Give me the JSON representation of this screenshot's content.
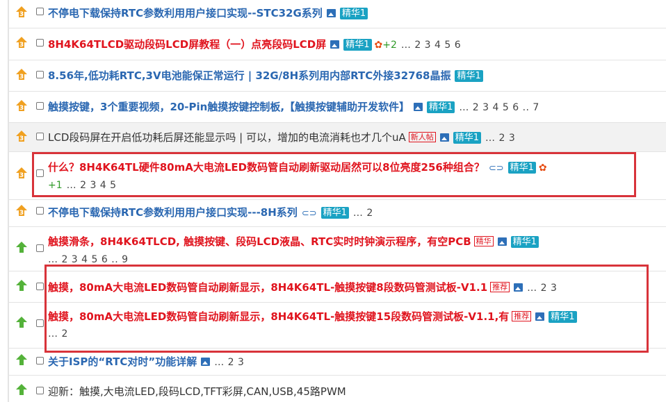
{
  "threads": [
    {
      "icon": "hot-3-icon",
      "title": "不停电下载保持RTC参数利用用户接口实现--STC32G系列",
      "color": "blue",
      "has_image": true,
      "badge": "精华1",
      "pages": ""
    },
    {
      "icon": "hot-3-icon",
      "title": "8H4K64TLCD驱动段码LCD屏教程（一）点亮段码LCD屏",
      "color": "red",
      "has_image": true,
      "badge": "精华1",
      "plus": "+2",
      "pages": "… 2 3 4 5 6"
    },
    {
      "icon": "hot-3-icon",
      "title": "8.56年,低功耗RTC,3V电池能保正常运行 | 32G/8H系列用内部RTC外接32768晶振",
      "color": "blue",
      "has_image": false,
      "badge": "精华1",
      "pages": ""
    },
    {
      "icon": "hot-3-icon",
      "title": "触摸按键，3个重要视频，20-Pin触摸按键控制板,【触摸按键辅助开发软件】",
      "color": "blue",
      "has_image": true,
      "badge": "精华1",
      "pages": "… 2 3 4 5 6 .. 7"
    },
    {
      "icon": "hot-3-icon",
      "title": "LCD段码屏在开启低功耗后屏还能显示吗 | 可以，增加的电流消耗也才几个uA",
      "color": "normal",
      "newbie": "新人帖",
      "has_image": true,
      "badge": "精华1",
      "pages": "… 2 3"
    },
    {
      "icon": "hot-3-icon",
      "title": "什么？8H4K64TL硬件80mA大电流LED数码管自动刷新驱动居然可以8位亮度256种组合？",
      "color": "red",
      "has_clip": true,
      "badge": "精华1",
      "plus": "+1",
      "pages": "… 2 3 4 5"
    },
    {
      "icon": "hot-3-icon",
      "title": "不停电下载保持RTC参数利用用户接口实现---8H系列",
      "color": "blue",
      "has_clip": true,
      "badge": "精华1",
      "pages": "… 2"
    },
    {
      "icon": "up-arrow-icon",
      "title": "触摸滑条，8H4K64TLCD, 触摸按键、段码LCD液晶、RTC实时时钟演示程序，有空PCB",
      "color": "red",
      "tag": "精华",
      "badge": "精华1",
      "pages": "… 2 3 4 5 6 .. 9"
    },
    {
      "icon": "up-arrow-icon",
      "title": "触摸，80mA大电流LED数码管自动刷新显示，8H4K64TL-触摸按键8段数码管测试板-V1.1",
      "color": "red",
      "tag": "推荐",
      "has_image": true,
      "pages": "… 2 3"
    },
    {
      "icon": "up-arrow-icon",
      "title": "触摸，80mA大电流LED数码管自动刷新显示，8H4K64TL-触摸按键15段数码管测试板-V1.1,有",
      "color": "red",
      "tag": "推荐",
      "has_image": true,
      "badge": "精华1",
      "pages": "… 2"
    },
    {
      "icon": "up-arrow-icon",
      "title": "关于ISP的“RTC对时”功能详解",
      "color": "blue",
      "has_image": true,
      "pages": "… 2 3"
    },
    {
      "icon": "up-arrow-icon",
      "title": "迎新：触摸,大电流LED,段码LCD,TFT彩屏,CAN,USB,45路PWM",
      "color": "normal",
      "pages": ""
    }
  ],
  "colors": {
    "blue": "#2a67b1",
    "red": "#e0141e",
    "badge": "#1aa2c3",
    "highlight": "#d8333a",
    "hot": "#f0a020",
    "up": "#54b23a"
  }
}
